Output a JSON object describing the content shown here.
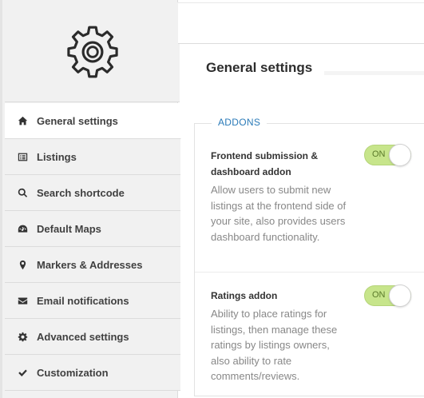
{
  "sidebar": {
    "logo_icon": "gear-icon",
    "items": [
      {
        "label": "General settings",
        "icon": "home-icon",
        "active": true
      },
      {
        "label": "Listings",
        "icon": "list-icon"
      },
      {
        "label": "Search shortcode",
        "icon": "search-icon"
      },
      {
        "label": "Default Maps",
        "icon": "dashboard-icon"
      },
      {
        "label": "Markers & Addresses",
        "icon": "map-marker-icon"
      },
      {
        "label": "Email notifications",
        "icon": "envelope-icon"
      },
      {
        "label": "Advanced settings",
        "icon": "cog-icon"
      },
      {
        "label": "Customization",
        "icon": "check-icon"
      }
    ]
  },
  "main": {
    "title": "General settings",
    "section_legend": "ADDONS",
    "addons": [
      {
        "title": "Frontend submission & dashboard addon",
        "description": "Allow users to submit new listings at the frontend side of your site, also provides users dashboard functionality.",
        "toggle_label": "ON"
      },
      {
        "title": "Ratings addon",
        "description": "Ability to place ratings for listings, then manage these ratings by listings owners, also ability to rate comments/reviews.",
        "toggle_label": "ON"
      }
    ]
  },
  "colors": {
    "accent_legend": "#2a7ab8",
    "toggle_on": "#c7e58b"
  }
}
